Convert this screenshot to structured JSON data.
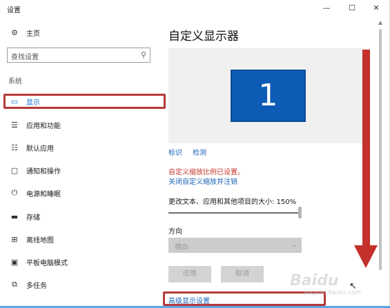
{
  "window": {
    "title": "设置",
    "minimize": "—",
    "maximize": "☐",
    "close": "✕"
  },
  "nav": {
    "home_label": "主页",
    "search_placeholder": "查找设置",
    "section_label": "系统",
    "items": [
      {
        "label": "显示",
        "icon": "monitor-icon",
        "active": true
      },
      {
        "label": "应用和功能",
        "icon": "apps-list-icon"
      },
      {
        "label": "默认应用",
        "icon": "default-apps-icon"
      },
      {
        "label": "通知和操作",
        "icon": "notification-icon"
      },
      {
        "label": "电源和睡眠",
        "icon": "power-icon"
      },
      {
        "label": "存储",
        "icon": "storage-icon"
      },
      {
        "label": "离线地图",
        "icon": "map-icon"
      },
      {
        "label": "平板电脑模式",
        "icon": "tablet-icon"
      },
      {
        "label": "多任务",
        "icon": "multitask-icon"
      }
    ]
  },
  "content": {
    "title": "自定义显示器",
    "monitor_number": "1",
    "identify_link": "标识",
    "detect_link": "检测",
    "custom_scale_warning": "自定义缩放比例已设置。",
    "custom_scale_off_link": "关闭自定义缩放并注销",
    "text_size_label": "更改文本、应用和其他项目的大小: 150%",
    "text_size_value": 1.0,
    "orientation_label": "方向",
    "orientation_value": "横向",
    "apply_button": "应用",
    "cancel_button": "取消",
    "advanced_link": "高级显示设置"
  },
  "colors": {
    "accent": "#1a6fc9",
    "highlight_box": "#b43a3a",
    "arrow": "#c4302b",
    "monitor": "#0d5bb5"
  },
  "watermark": {
    "text": "Baidu",
    "sub": "jingyan.baidu.com"
  }
}
